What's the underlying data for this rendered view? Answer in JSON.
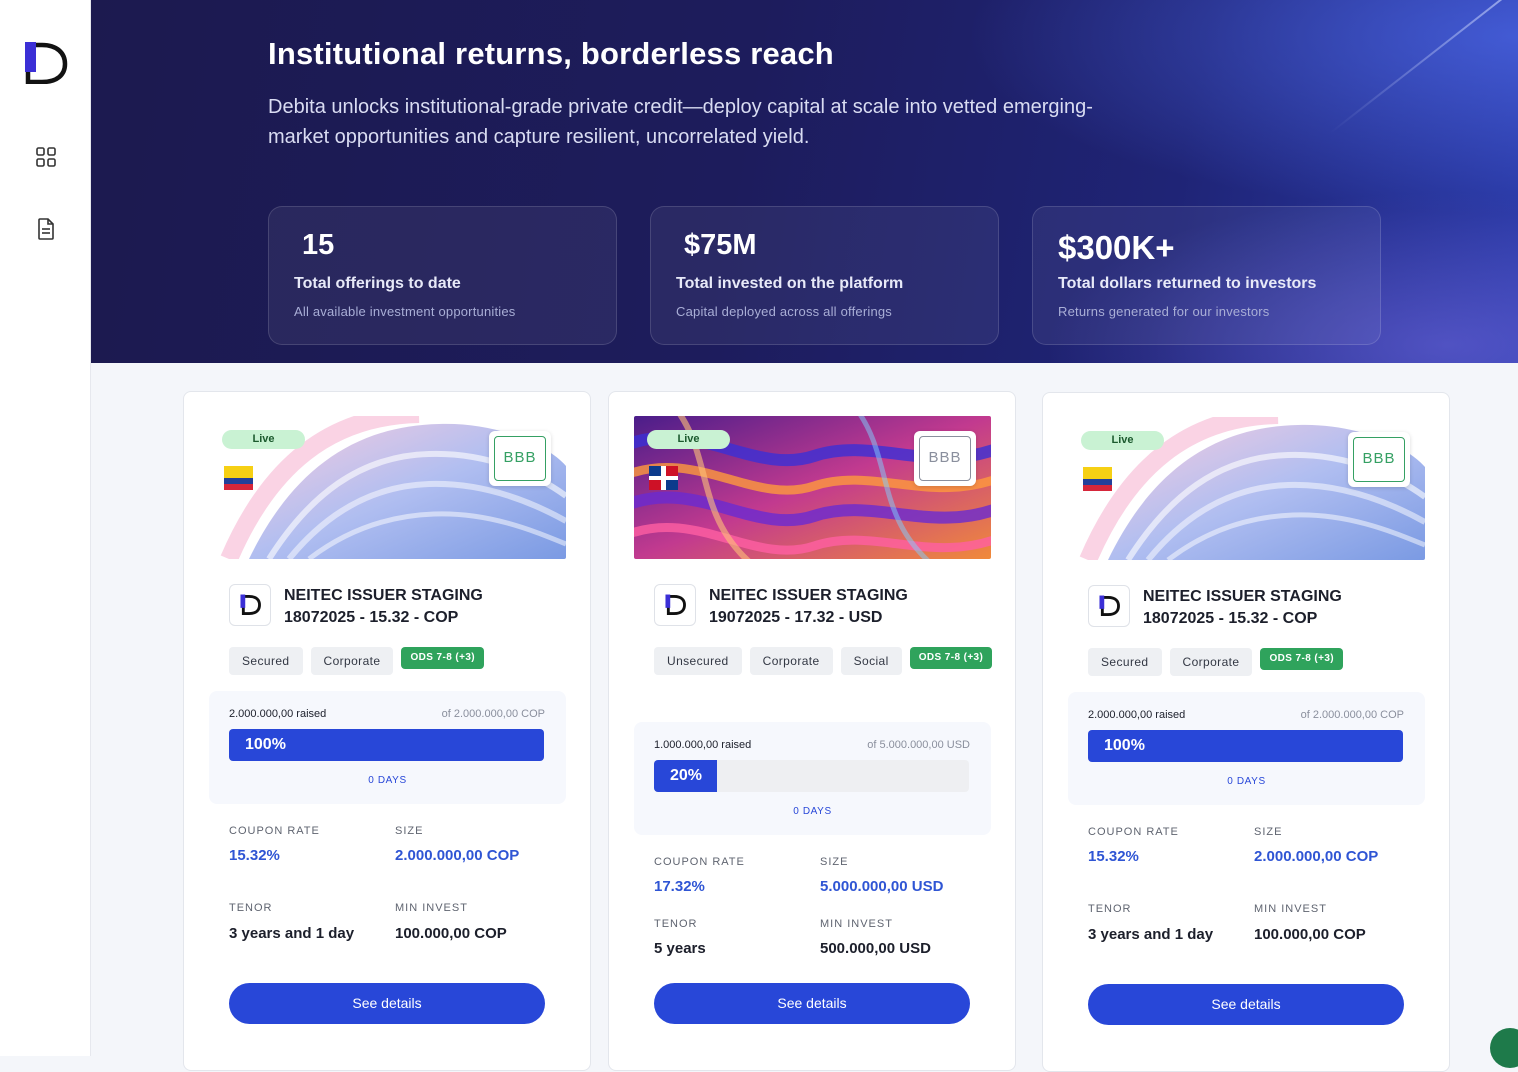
{
  "hero": {
    "title": "Institutional returns, borderless reach",
    "subtitle": "Debita unlocks institutional-grade private credit—deploy capital at scale into vetted emerging-market opportunities and capture resilient, uncorrelated yield."
  },
  "stats": [
    {
      "value": "15",
      "label": "Total offerings to date",
      "desc": "All available investment opportunities"
    },
    {
      "value": "$75M",
      "label": "Total invested on the platform",
      "desc": "Capital deployed across all offerings"
    },
    {
      "value": "$300K+",
      "label": "Total dollars returned to investors",
      "desc": "Returns generated for our investors"
    }
  ],
  "cards": [
    {
      "status": "Live",
      "rating": "BBB",
      "flag": "colombia",
      "name_line1": "NEITEC ISSUER STAGING",
      "name_line2": "18072025 - 15.32 - COP",
      "tags": [
        "Secured",
        "Corporate"
      ],
      "ods": "ODS 7-8 (+3)",
      "raised": "2.000.000,00 raised",
      "of": "of 2.000.000,00 COP",
      "progress_label": "100%",
      "progress": 1.0,
      "days": "0 DAYS",
      "coupon_label": "COUPON RATE",
      "coupon": "15.32%",
      "size_label": "SIZE",
      "size": "2.000.000,00 COP",
      "tenor_label": "TENOR",
      "tenor": "3 years and 1 day",
      "min_label": "MIN INVEST",
      "min": "100.000,00 COP",
      "button": "See details"
    },
    {
      "status": "Live",
      "rating": "BBB",
      "flag": "dominican-republic",
      "name_line1": "NEITEC ISSUER STAGING",
      "name_line2": "19072025 - 17.32 - USD",
      "tags": [
        "Unsecured",
        "Corporate",
        "Social"
      ],
      "ods": "ODS 7-8 (+3)",
      "raised": "1.000.000,00 raised",
      "of": "of 5.000.000,00 USD",
      "progress_label": "20%",
      "progress": 0.2,
      "days": "0 DAYS",
      "coupon_label": "COUPON RATE",
      "coupon": "17.32%",
      "size_label": "SIZE",
      "size": "5.000.000,00 USD",
      "tenor_label": "TENOR",
      "tenor": "5 years",
      "min_label": "MIN INVEST",
      "min": "500.000,00 USD",
      "button": "See details"
    },
    {
      "status": "Live",
      "rating": "BBB",
      "flag": "colombia",
      "name_line1": "NEITEC ISSUER STAGING",
      "name_line2": "18072025 - 15.32 - COP",
      "tags": [
        "Secured",
        "Corporate"
      ],
      "ods": "ODS 7-8 (+3)",
      "raised": "2.000.000,00 raised",
      "of": "of 2.000.000,00 COP",
      "progress_label": "100%",
      "progress": 1.0,
      "days": "0 DAYS",
      "coupon_label": "COUPON RATE",
      "coupon": "15.32%",
      "size_label": "SIZE",
      "size": "2.000.000,00 COP",
      "tenor_label": "TENOR",
      "tenor": "3 years and 1 day",
      "min_label": "MIN INVEST",
      "min": "100.000,00 COP",
      "button": "See details"
    }
  ],
  "colors": {
    "accent": "#2847d8",
    "green": "#2fa35c",
    "hero_bg": "#1d1c5c"
  }
}
